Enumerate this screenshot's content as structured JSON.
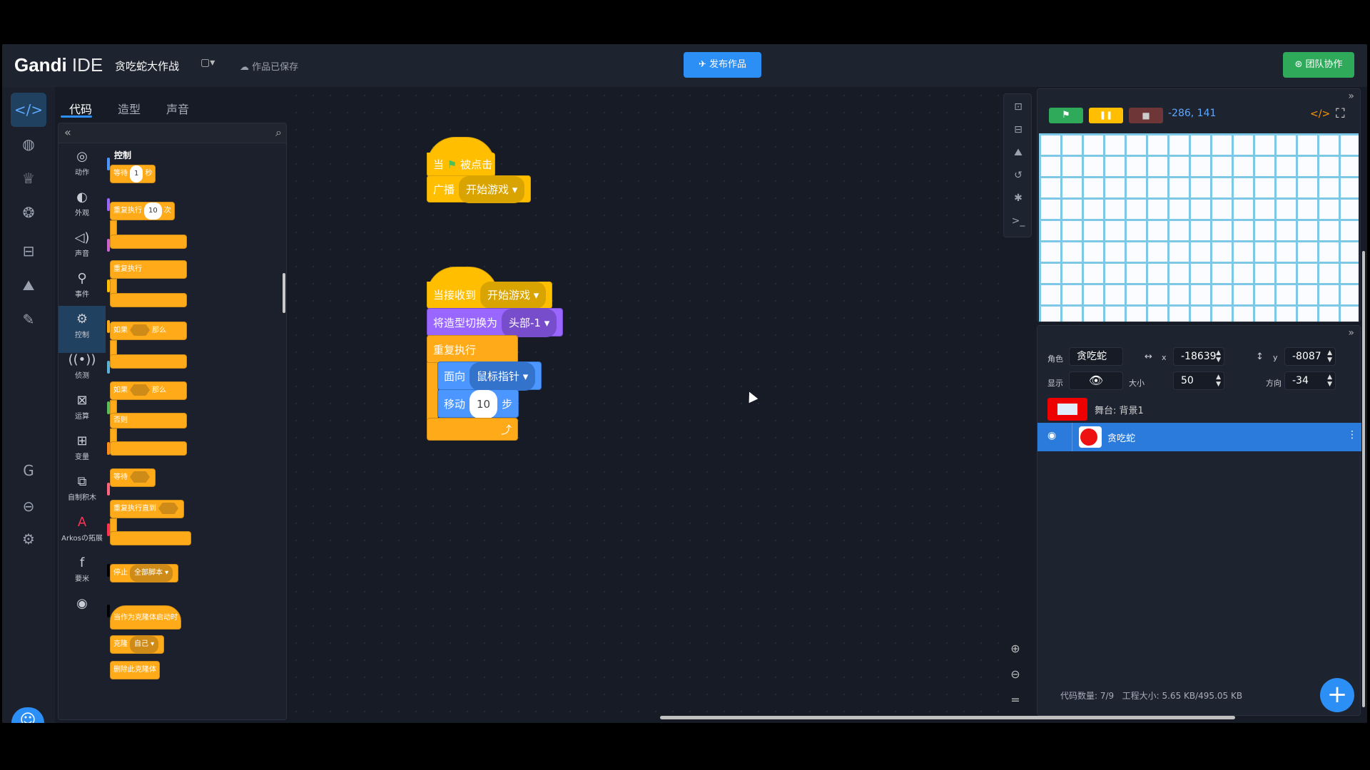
{
  "app": {
    "logo_bold": "Gandi",
    "logo_rest": " IDE",
    "project_title": "贪吃蛇大作战",
    "folder_icon": "▢▾",
    "saved_status": "☁ 作品已保存",
    "publish": "✈ 发布作品",
    "team": "⊛ 团队协作"
  },
  "tabs": [
    "代码",
    "造型",
    "声音"
  ],
  "palette": {
    "collapse": "«",
    "search_icon": "⌕",
    "section_label": "控制",
    "categories": [
      {
        "label": "动作",
        "icon": "◎",
        "color": "#4c97ff"
      },
      {
        "label": "外观",
        "icon": "◐",
        "color": "#9966ff"
      },
      {
        "label": "声音",
        "icon": "◁)",
        "color": "#cf63cf"
      },
      {
        "label": "事件",
        "icon": "⚲",
        "color": "#ffbf00"
      },
      {
        "label": "控制",
        "icon": "⚙",
        "color": "#ffab19"
      },
      {
        "label": "侦测",
        "icon": "((•))",
        "color": "#5cb1d6"
      },
      {
        "label": "运算",
        "icon": "⊠",
        "color": "#59c059"
      },
      {
        "label": "变量",
        "icon": "⊞",
        "color": "#ff8c1a"
      },
      {
        "label": "自制积木",
        "icon": "⧉",
        "color": "#ff6680"
      },
      {
        "label": "Arkosの拓展",
        "icon": "A",
        "color": "#ff3355"
      },
      {
        "label": "要米",
        "icon": "f",
        "color": "#000000"
      },
      {
        "label": "",
        "icon": "◉",
        "color": "#000000"
      }
    ],
    "blocks": {
      "wait": "等待",
      "wait_num": "1",
      "wait_unit": "秒",
      "repeat": "重复执行",
      "repeat_num": "10",
      "repeat_unit": "次",
      "forever": "重复执行",
      "if1": "如果",
      "then1": "那么",
      "if2": "如果",
      "then2": "那么",
      "else": "否则",
      "wait_until": "等待",
      "repeat_until": "重复执行直到",
      "stop": "停止",
      "stop_opt": "全部脚本 ▾",
      "clone_start": "当作为克隆体启动时",
      "clone": "克隆",
      "clone_opt": "自己 ▾",
      "delete_clone": "删除此克隆体"
    }
  },
  "script1": {
    "when": "当",
    "flag": "⚑",
    "clicked": "被点击",
    "broadcast": "广播",
    "broadcast_opt": "开始游戏 ▾"
  },
  "script2": {
    "when_receive": "当接收到",
    "receive_opt": "开始游戏 ▾",
    "switch_costume": "将造型切换为",
    "costume_opt": "头部-1 ▾",
    "forever": "重复执行",
    "point": "面向",
    "point_opt": "鼠标指针 ▾",
    "move": "移动",
    "move_num": "10",
    "move_unit": "步",
    "loop_arrow": "⤴"
  },
  "stage": {
    "coords": "-286, 141",
    "code_icon": "</>",
    "fullscreen": "⛶",
    "collapse": "»",
    "flag_icon": "⚑",
    "pause_icon": "❚❚",
    "stop_icon": "■"
  },
  "sprite": {
    "role_label": "角色",
    "name": "贪吃蛇",
    "x_label": "x",
    "x_value": "-18639",
    "y_label": "y",
    "y_value": "-8087",
    "show_label": "显示",
    "size_label": "大小",
    "size_value": "50",
    "dir_label": "方向",
    "dir_value": "-34",
    "stage_label": "舞台: 背景1",
    "sprite_item": "贪吃蛇",
    "code_count": "代码数量: 7/9",
    "project_size": "工程大小: 5.65 KB/495.05 KB",
    "add": "+",
    "collapse": "»"
  },
  "colors": {
    "accent": "#2b8ff5",
    "team": "#2faa5b",
    "selected": "#2b7bdc"
  }
}
